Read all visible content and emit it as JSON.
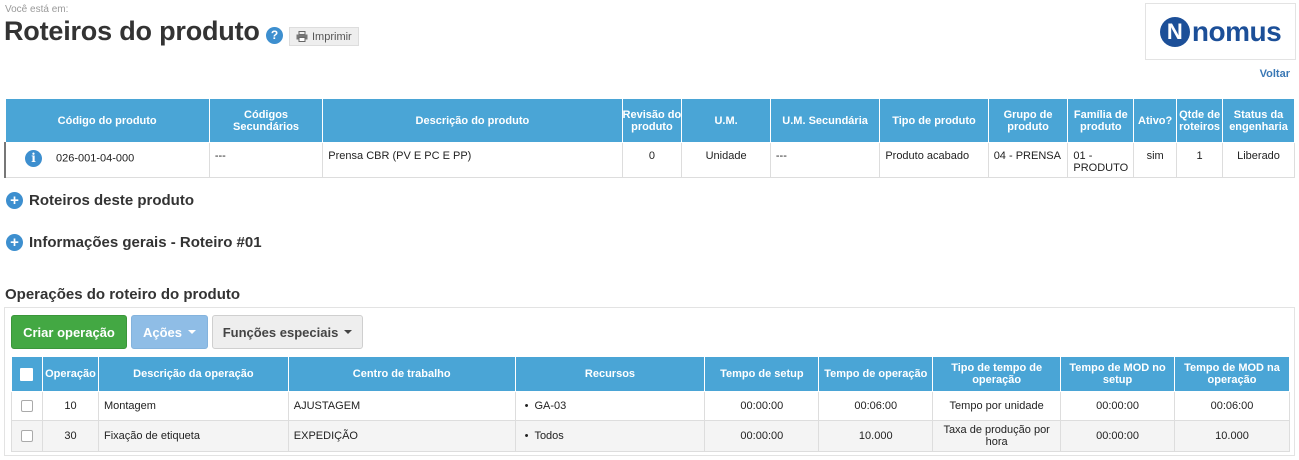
{
  "breadcrumb_hint": "Você está em:",
  "page_title": "Roteiros do produto",
  "help_icon": "?",
  "print_label": "Imprimir",
  "logo": {
    "mark": "N",
    "text": "nomus"
  },
  "back_label": "Voltar",
  "product_table": {
    "headers": [
      "Código do produto",
      "Códigos Secundários",
      "Descrição do produto",
      "Revisão do produto",
      "U.M.",
      "U.M. Secundária",
      "Tipo de produto",
      "Grupo de produto",
      "Família de produto",
      "Ativo?",
      "Qtde de roteiros",
      "Status da engenharia"
    ],
    "row": {
      "info_icon": "i",
      "codigo": "026-001-04-000",
      "codigos_secundarios": "---",
      "descricao": "Prensa CBR (PV E PC E PP)",
      "revisao": "0",
      "um": "Unidade",
      "um_secundaria": "---",
      "tipo": "Produto acabado",
      "grupo": "04 - PRENSA",
      "familia": "01 - PRODUTO",
      "ativo": "sim",
      "qtde_roteiros": "1",
      "status": "Liberado"
    }
  },
  "sections": {
    "roteiros": "Roteiros deste produto",
    "informacoes": "Informações gerais - Roteiro #01"
  },
  "operations": {
    "heading": "Operações do roteiro do produto",
    "create_label": "Criar operação",
    "actions_label": "Ações",
    "special_label": "Funções especiais",
    "headers": [
      "Operação",
      "Descrição da operação",
      "Centro de trabalho",
      "Recursos",
      "Tempo de setup",
      "Tempo de operação",
      "Tipo de tempo de operação",
      "Tempo de MOD no setup",
      "Tempo de MOD na operação"
    ],
    "rows": [
      {
        "operacao": "10",
        "descricao": "Montagem",
        "centro": "AJUSTAGEM",
        "recurso": "GA-03",
        "setup": "00:00:00",
        "tempo_op": "00:06:00",
        "tipo_tempo": "Tempo por unidade",
        "mod_setup": "00:00:00",
        "mod_op": "00:06:00"
      },
      {
        "operacao": "30",
        "descricao": "Fixação de etiqueta",
        "centro": "EXPEDIÇÃO",
        "recurso": "Todos",
        "setup": "00:00:00",
        "tempo_op": "10.000",
        "tipo_tempo": "Taxa de produção por hora",
        "mod_setup": "00:00:00",
        "mod_op": "10.000"
      }
    ]
  },
  "colors": {
    "header_blue": "#4aa5d6",
    "create_green": "#43a843",
    "actions_blue": "#8fbde6",
    "logo_blue": "#1c4f98"
  }
}
